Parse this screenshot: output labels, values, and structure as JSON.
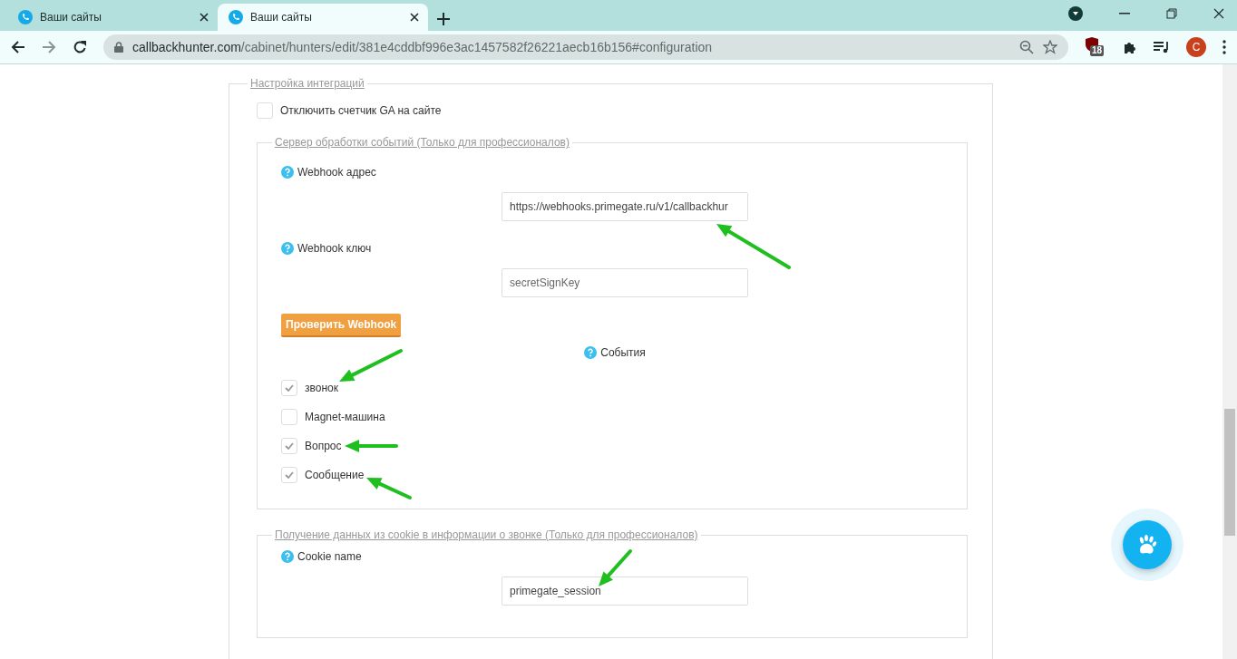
{
  "browser": {
    "tabs": [
      {
        "title": "Ваши сайты",
        "selected": false
      },
      {
        "title": "Ваши сайты",
        "selected": true
      }
    ],
    "address": {
      "domain": "callbackhunter.com",
      "path": "/cabinet/hunters/edit/381e4cddbf996e3ac1457582f26221aecb16b156#configuration"
    },
    "extension_badge": "18",
    "profile_initial": "C"
  },
  "integration": {
    "legend": "Настройка интеграций",
    "disable_ga": {
      "label": "Отключить счетчик GA на сайте",
      "checked": false
    },
    "webhook_section": {
      "legend": "Сервер обработки событий (Только для профессионалов)",
      "fields": [
        {
          "label": "Webhook адрес",
          "value": "https://webhooks.primegate.ru/v1/callbackhur"
        },
        {
          "label": "Webhook ключ",
          "placeholder": "secretSignKey"
        }
      ],
      "test_button": "Проверить Webhook",
      "events_label": "События",
      "events": [
        {
          "label": "звонок",
          "checked": true
        },
        {
          "label": "Magnet-машина",
          "checked": false
        },
        {
          "label": "Вопрос",
          "checked": true
        },
        {
          "label": "Сообщение",
          "checked": true
        }
      ]
    },
    "cookie_section": {
      "legend": "Получение данных из cookie в информации о звонке (Только для профессионалов)",
      "field": {
        "label": "Cookie name",
        "value": "primegate_session"
      }
    }
  }
}
